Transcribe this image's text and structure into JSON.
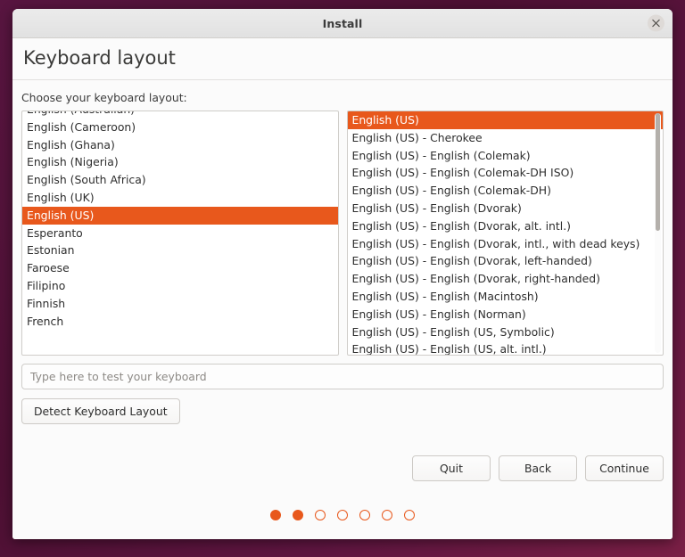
{
  "window": {
    "title": "Install",
    "close_icon": "close-icon"
  },
  "page": {
    "heading": "Keyboard layout",
    "choose_label": "Choose your keyboard layout:"
  },
  "layout_list": {
    "clipped_top_item": "",
    "items": [
      "English (Australian)",
      "English (Cameroon)",
      "English (Ghana)",
      "English (Nigeria)",
      "English (South Africa)",
      "English (UK)",
      "English (US)",
      "Esperanto",
      "Estonian",
      "Faroese",
      "Filipino",
      "Finnish",
      "French"
    ],
    "selected": "English (US)"
  },
  "variant_list": {
    "items": [
      "English (US)",
      "English (US) - Cherokee",
      "English (US) - English (Colemak)",
      "English (US) - English (Colemak-DH ISO)",
      "English (US) - English (Colemak-DH)",
      "English (US) - English (Dvorak)",
      "English (US) - English (Dvorak, alt. intl.)",
      "English (US) - English (Dvorak, intl., with dead keys)",
      "English (US) - English (Dvorak, left-handed)",
      "English (US) - English (Dvorak, right-handed)",
      "English (US) - English (Macintosh)",
      "English (US) - English (Norman)",
      "English (US) - English (US, Symbolic)",
      "English (US) - English (US, alt. intl.)"
    ],
    "selected": "English (US)",
    "scrollbar": "vertical-scrollbar"
  },
  "test_field": {
    "placeholder": "Type here to test your keyboard",
    "value": ""
  },
  "detect_button": {
    "label": "Detect Keyboard Layout"
  },
  "footer": {
    "quit": "Quit",
    "back": "Back",
    "continue": "Continue"
  },
  "progress": {
    "total_steps": 7,
    "current_step": 2,
    "states": [
      "filled",
      "filled",
      "hollow",
      "hollow",
      "hollow",
      "hollow",
      "hollow"
    ]
  },
  "colors": {
    "accent": "#e8581c",
    "desktop_background": "#4d1033",
    "window_background": "#fbfbfb",
    "titlebar": "#e6e6e6"
  }
}
